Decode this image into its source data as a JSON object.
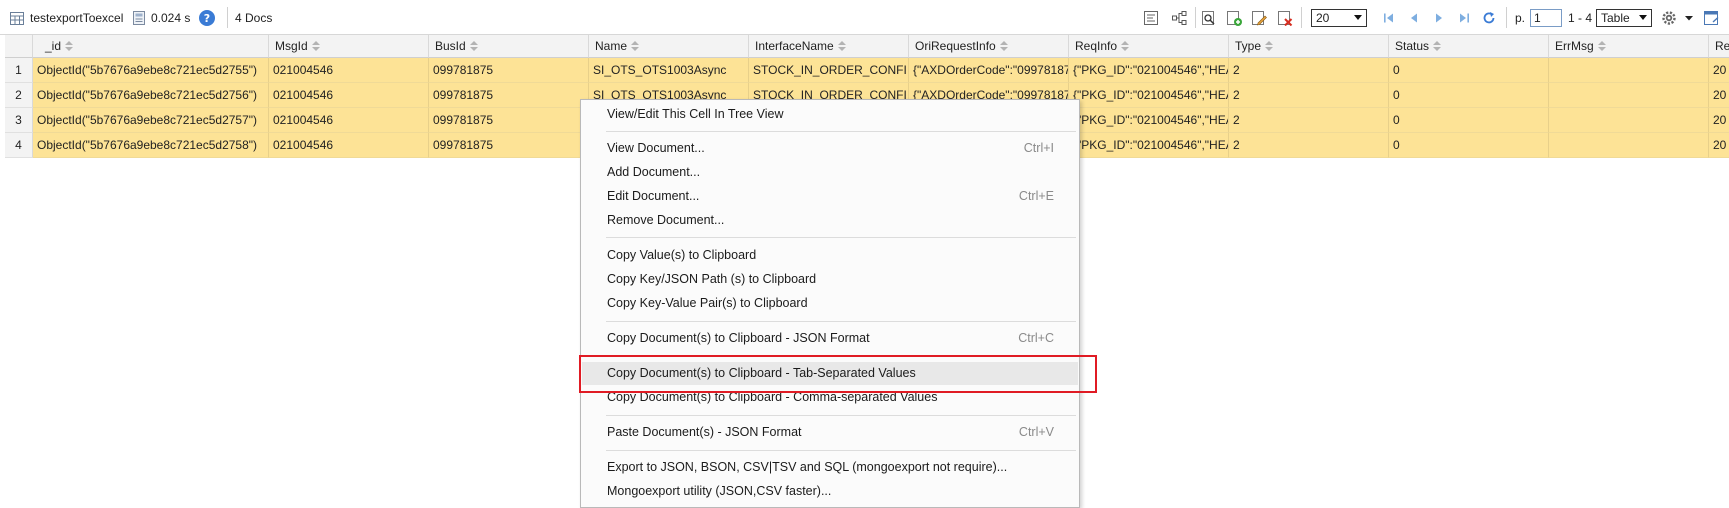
{
  "toolbar": {
    "collection_name": "testexportToexcel",
    "query_time": "0.024 s",
    "doc_count": "4 Docs",
    "page_size": "20",
    "page_label": "p.",
    "page_number": "1",
    "range": "1 - 4",
    "view_mode": "Table"
  },
  "columns": [
    "_id",
    "MsgId",
    "BusId",
    "Name",
    "InterfaceName",
    "OriRequestInfo",
    "ReqInfo",
    "Type",
    "Status",
    "ErrMsg",
    "Re"
  ],
  "rows": [
    {
      "num": "1",
      "cells": [
        "ObjectId(\"5b7676a9ebe8c721ec5d2755\")",
        "021004546",
        "099781875",
        "SI_OTS_OTS1003Async",
        "STOCK_IN_ORDER_CONFI",
        "{\"AXDOrderCode\":\"09978187",
        "{\"PKG_ID\":\"021004546\",\"HEA",
        "2",
        "0",
        "",
        "20"
      ]
    },
    {
      "num": "2",
      "cells": [
        "ObjectId(\"5b7676a9ebe8c721ec5d2756\")",
        "021004546",
        "099781875",
        "SI_OTS_OTS1003Async",
        "STOCK_IN_ORDER_CONFI",
        "{\"AXDOrderCode\":\"09978187",
        "{\"PKG_ID\":\"021004546\",\"HEA",
        "2",
        "0",
        "",
        "20"
      ]
    },
    {
      "num": "3",
      "cells": [
        "ObjectId(\"5b7676a9ebe8c721ec5d2757\")",
        "021004546",
        "099781875",
        "",
        "",
        "",
        "{\"PKG_ID\":\"021004546\",\"HEA",
        "2",
        "0",
        "",
        "20"
      ]
    },
    {
      "num": "4",
      "cells": [
        "ObjectId(\"5b7676a9ebe8c721ec5d2758\")",
        "021004546",
        "099781875",
        "",
        "",
        "",
        "{\"PKG_ID\":\"021004546\",\"HEA",
        "2",
        "0",
        "",
        "20"
      ]
    }
  ],
  "context_menu": {
    "items": [
      {
        "label": "View/Edit This Cell In Tree View",
        "shortcut": ""
      },
      {
        "label": "View Document...",
        "shortcut": "Ctrl+I"
      },
      {
        "label": "Add Document...",
        "shortcut": ""
      },
      {
        "label": "Edit Document...",
        "shortcut": "Ctrl+E"
      },
      {
        "label": "Remove Document...",
        "shortcut": ""
      },
      {
        "label": "Copy Value(s) to Clipboard",
        "shortcut": ""
      },
      {
        "label": "Copy Key/JSON Path (s) to Clipboard",
        "shortcut": ""
      },
      {
        "label": "Copy Key-Value Pair(s) to Clipboard",
        "shortcut": ""
      },
      {
        "label": "Copy Document(s) to Clipboard - JSON Format",
        "shortcut": "Ctrl+C"
      },
      {
        "label": "Copy Document(s) to Clipboard - Tab-Separated Values",
        "shortcut": ""
      },
      {
        "label": "Copy Document(s) to Clipboard - Comma-separated Values",
        "shortcut": ""
      },
      {
        "label": "Paste Document(s) - JSON Format",
        "shortcut": "Ctrl+V"
      },
      {
        "label": "Export to JSON, BSON, CSV|TSV and SQL (mongoexport not require)...",
        "shortcut": ""
      },
      {
        "label": "Mongoexport utility (JSON,CSV faster)...",
        "shortcut": ""
      }
    ],
    "highlighted_item": "Copy Document(s) to Clipboard - Tab-Separated Values"
  },
  "colors": {
    "row_bg": "#fde396",
    "header_bg": "#f3f3f3",
    "highlight_box": "#e01b24",
    "nav_icon": "#5b9bd5"
  }
}
